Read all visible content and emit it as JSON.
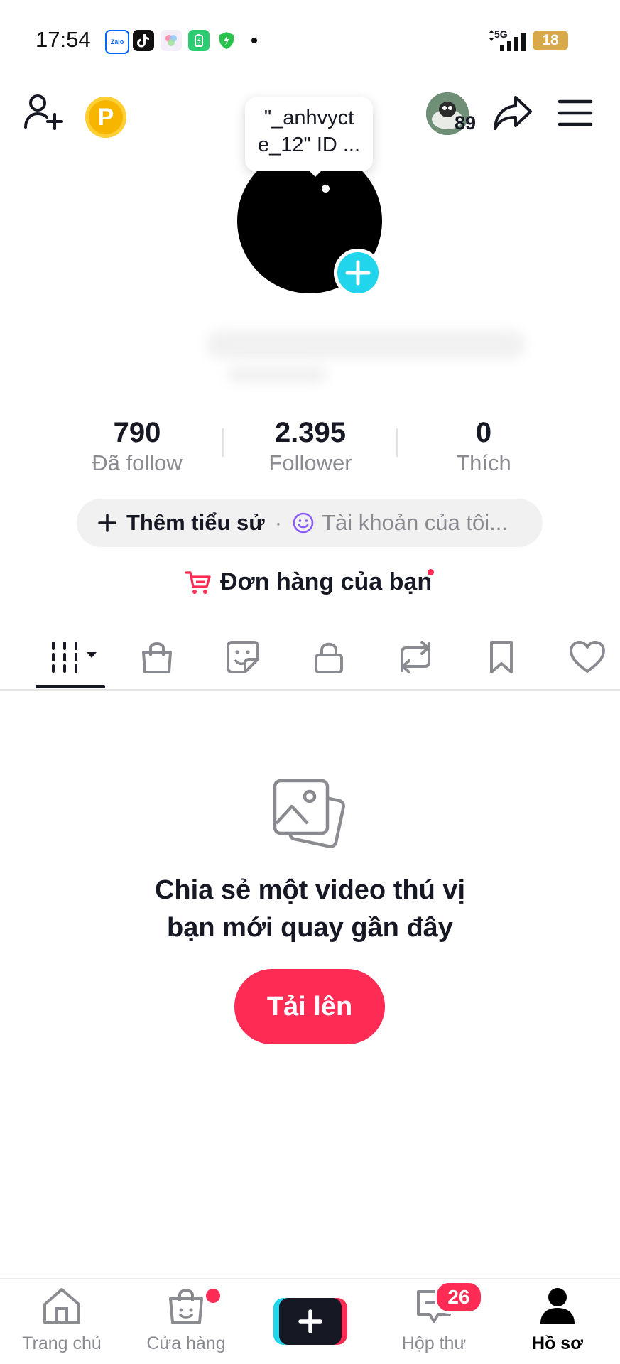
{
  "status_bar": {
    "time": "17:54",
    "apps": [
      "Zalo",
      "TikTok",
      "Photos",
      "Battery app",
      "Shield"
    ],
    "network": "5G",
    "battery": "18"
  },
  "header": {
    "coin_letter": "P",
    "friend_count": "89",
    "icons": [
      "add-friend-icon",
      "coin-icon",
      "share-icon",
      "menu-icon"
    ]
  },
  "profile": {
    "username_tooltip": "\"_anhvyct\ne_12\" ID ..."
  },
  "stats": [
    {
      "value": "790",
      "label": "Đã follow"
    },
    {
      "value": "2.395",
      "label": "Follower"
    },
    {
      "value": "0",
      "label": "Thích"
    }
  ],
  "bio": {
    "add_label": "Thêm tiểu sử",
    "separator": "·",
    "account_label": "Tài khoản của tôi..."
  },
  "orders": {
    "label": "Đơn hàng của bạn"
  },
  "tabs": [
    "videos-grid",
    "shop",
    "stickers",
    "private",
    "reposts",
    "saved",
    "liked"
  ],
  "empty_state": {
    "line1": "Chia sẻ một video thú vị",
    "line2": "bạn mới quay gần đây",
    "button": "Tải lên"
  },
  "bottom_nav": {
    "home": "Trang chủ",
    "shop": "Cửa hàng",
    "inbox": "Hộp thư",
    "inbox_badge": "26",
    "profile": "Hồ sơ"
  },
  "colors": {
    "accent": "#fe2c55",
    "cyan": "#20d5ec",
    "text": "#161823",
    "muted": "#8a8b91"
  }
}
